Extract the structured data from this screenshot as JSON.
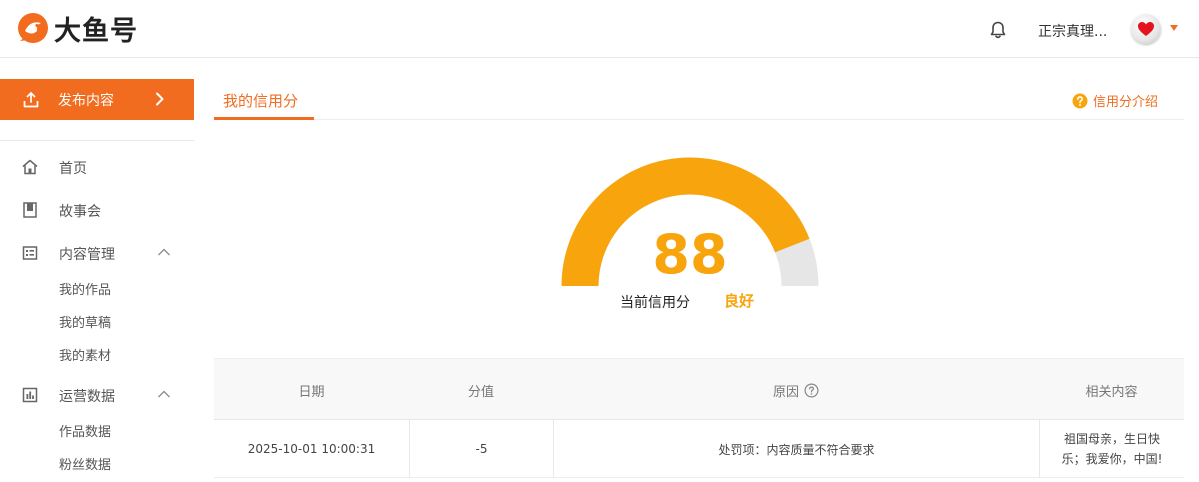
{
  "header": {
    "logo_text": "大鱼号",
    "username": "正宗真理...",
    "brand_color": "#f26c1f"
  },
  "sidebar": {
    "publish_label": "发布内容",
    "items": [
      {
        "label": "首页",
        "icon": "home-icon"
      },
      {
        "label": "故事会",
        "icon": "book-icon"
      },
      {
        "label": "内容管理",
        "icon": "content-list-icon",
        "expanded": true,
        "children": [
          "我的作品",
          "我的草稿",
          "我的素材"
        ]
      },
      {
        "label": "运营数据",
        "icon": "bar-chart-icon",
        "expanded": true,
        "children": [
          "作品数据",
          "粉丝数据"
        ]
      }
    ]
  },
  "main": {
    "tab_label": "我的信用分",
    "help_label": "信用分介绍",
    "score": "88",
    "score_value": 88,
    "score_max": 100,
    "score_label": "当前信用分",
    "grade": "良好",
    "gauge_color": "#f8a40d",
    "gauge_track_color": "#e6e6e6"
  },
  "table": {
    "columns": [
      "日期",
      "分值",
      "原因",
      "相关内容"
    ],
    "rows": [
      {
        "date": "2025-10-01 10:00:31",
        "value": "-5",
        "reason": "处罚项：内容质量不符合要求",
        "related": "祖国母亲，生日快乐；我爱你，中国!"
      }
    ]
  }
}
